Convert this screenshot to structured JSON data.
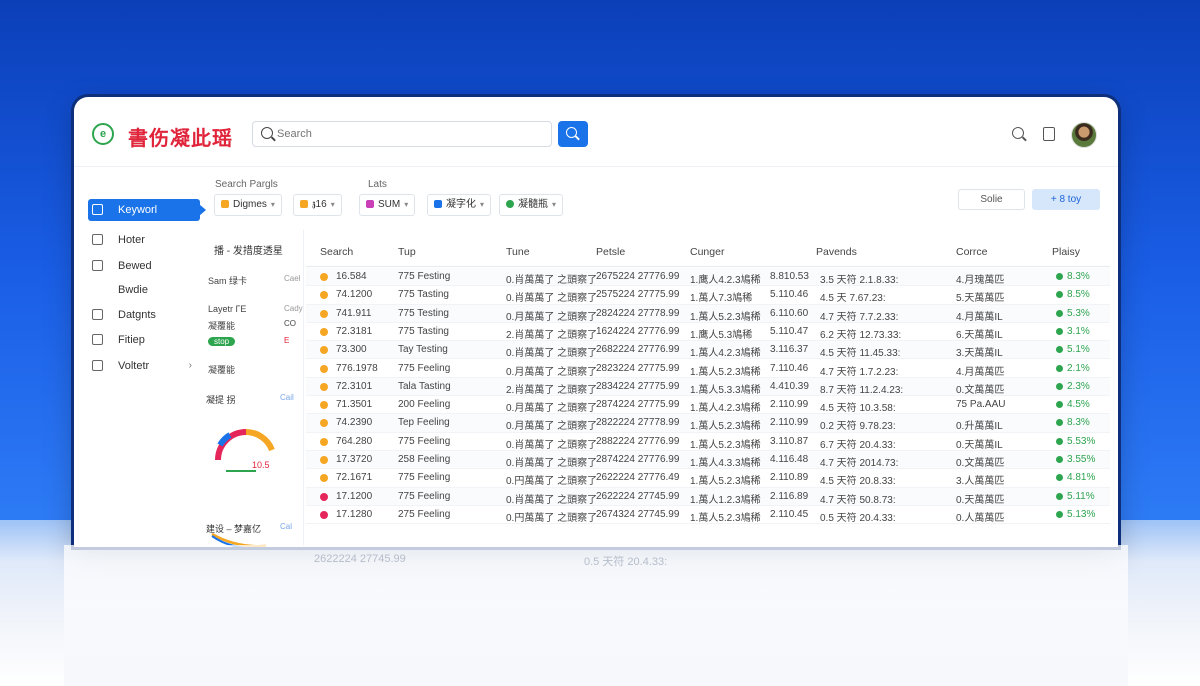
{
  "app": {
    "logo_text": "書伤凝此瑶"
  },
  "search": {
    "placeholder": "Search"
  },
  "sidebar": {
    "items": [
      {
        "label": "Keyworl"
      },
      {
        "label": "Hoter"
      },
      {
        "label": "Bewed"
      },
      {
        "label": "Bwdie"
      },
      {
        "label": "Datgnts"
      },
      {
        "label": "Fitiep"
      },
      {
        "label": "Voltetr"
      }
    ]
  },
  "filters": {
    "label_left": "Search Pargls",
    "label_right": "Lats",
    "chips": [
      "Digmes",
      "𝖟16",
      "SUM",
      "凝字化",
      "凝髓瓶"
    ],
    "btn_outline": "Solie",
    "btn_blue": "+ 8 toy"
  },
  "left_panel": {
    "header": "播 - 发措度透星",
    "rows": [
      {
        "left": "Sam 绿卡",
        "right": "Cael"
      },
      {
        "left": "Layetr ГЕ",
        "right": "Cady"
      },
      {
        "left": "凝覆能",
        "right": "CO"
      },
      {
        "left": "stop",
        "right": "E"
      },
      {
        "left": "凝覆能"
      }
    ],
    "gauge_title": "凝提 拐",
    "gauge_link": "Cail",
    "gauge_value": "10.5",
    "chart2_title": "建设 – 梦嘉亿",
    "chart2_link": "Cal"
  },
  "table": {
    "headers": [
      "Search",
      "Tup",
      "Tune",
      "Petsle",
      "Cunger",
      "Pavends",
      "Corrce",
      "Plaisy"
    ],
    "rows": [
      {
        "c1": "16.584",
        "c2": "775 Festing",
        "c3": "0.肖萬萬了 之頭察了",
        "c4": "2675224 27776.99",
        "c5": "1.鹰人4.2.3鳩稀",
        "c6": "8.810.53",
        "c7": "3.5 天符 2.1.8.33:",
        "c8": "4.月瑰萬匹",
        "c9": "8.3%",
        "dot": "#f5a623"
      },
      {
        "c1": "74.1200",
        "c2": "775 Tasting",
        "c3": "0.肖萬萬了 之頭察了",
        "c4": "2575224 27775.99",
        "c5": "1.萬人7.3鳩稀",
        "c6": "5.110.46",
        "c7": "4.5 天 7.67.23:",
        "c8": "5.天萬萬匹",
        "c9": "8.5%",
        "dot": "#f5a623"
      },
      {
        "c1": "741.911",
        "c2": "775 Testing",
        "c3": "0.月萬萬了 之頭察了",
        "c4": "2824224 27778.99",
        "c5": "1.萬人5.2.3鳩稀",
        "c6": "6.110.60",
        "c7": "4.7 天符 7.7.2.33:",
        "c8": "4.月萬萬IL",
        "c9": "5.3%",
        "dot": "#f5a623"
      },
      {
        "c1": "72.3181",
        "c2": "775 Tasting",
        "c3": "2.肖萬萬了 之頭察了",
        "c4": "1624224 27776.99",
        "c5": "1.鹰人5.3鳩稀",
        "c6": "5.110.47",
        "c7": "6.2 天符 12.73.33:",
        "c8": "6.天萬萬IL",
        "c9": "3.1%",
        "dot": "#f5a623"
      },
      {
        "c1": "73.300",
        "c2": "Tay Testing",
        "c3": "0.肖萬萬了 之頭察了",
        "c4": "2682224 27776.99",
        "c5": "1.萬人4.2.3鳩稀",
        "c6": "3.116.37",
        "c7": "4.5 天符 11.45.33:",
        "c8": "3.天萬萬IL",
        "c9": "5.1%",
        "dot": "#f5a623"
      },
      {
        "c1": "776.1978",
        "c2": "775 Feeling",
        "c3": "0.月萬萬了 之頭察了",
        "c4": "2823224 27775.99",
        "c5": "1.萬人5.2.3鳩稀",
        "c6": "7.110.46",
        "c7": "4.7 天符 1.7.2.23:",
        "c8": "4.月萬萬匹",
        "c9": "2.1%",
        "dot": "#f5a623"
      },
      {
        "c1": "72.3101",
        "c2": "Tala Tasting",
        "c3": "2.肖萬萬了 之頭察了",
        "c4": "2834224 27775.99",
        "c5": "1.萬人5.3.3鳩稀",
        "c6": "4.410.39",
        "c7": "8.7 天符 11.2.4.23:",
        "c8": "0.文萬萬匹",
        "c9": "2.3%",
        "dot": "#f5a623"
      },
      {
        "c1": "71.3501",
        "c2": "200 Feeling",
        "c3": "0.月萬萬了 之頭察了",
        "c4": "2874224 27775.99",
        "c5": "1.萬人4.2.3鳩稀",
        "c6": "2.110.99",
        "c7": "4.5 天符 10.3.58:",
        "c8": "75 Pa.AAU",
        "c9": "4.5%",
        "dot": "#f5a623"
      },
      {
        "c1": "74.2390",
        "c2": "Tep Feeling",
        "c3": "0.月萬萬了 之頭察了",
        "c4": "2822224 27778.99",
        "c5": "1.萬人5.2.3鳩稀",
        "c6": "2.110.99",
        "c7": "0.2 天符 9.78.23:",
        "c8": "0.升萬萬IL",
        "c9": "8.3%",
        "dot": "#f5a623"
      },
      {
        "c1": "764.280",
        "c2": "775 Feeling",
        "c3": "0.肖萬萬了 之頭察了",
        "c4": "2882224 27776.99",
        "c5": "1.萬人5.2.3鳩稀",
        "c6": "3.110.87",
        "c7": "6.7 天符 20.4.33:",
        "c8": "0.天萬萬IL",
        "c9": "5.53%",
        "dot": "#f5a623"
      },
      {
        "c1": "17.3720",
        "c2": "258 Feeling",
        "c3": "0.肖萬萬了 之頭察了",
        "c4": "2874224 27776.99",
        "c5": "1.萬人4.3.3鳩稀",
        "c6": "4.116.48",
        "c7": "4.7 天符 2014.73:",
        "c8": "0.文萬萬匹",
        "c9": "3.55%",
        "dot": "#f5a623"
      },
      {
        "c1": "72.1671",
        "c2": "775 Feeling",
        "c3": "0.円萬萬了 之頭察了",
        "c4": "2622224 27776.49",
        "c5": "1.萬人5.2.3鳩稀",
        "c6": "2.110.89",
        "c7": "4.5 天符 20.8.33:",
        "c8": "3.人萬萬匹",
        "c9": "4.81%",
        "dot": "#f5a623"
      },
      {
        "c1": "17.1200",
        "c2": "775 Feeling",
        "c3": "0.肖萬萬了 之頭察了",
        "c4": "2622224 27745.99",
        "c5": "1.萬人1.2.3鳩稀",
        "c6": "2.116.89",
        "c7": "4.7 天符 50.8.73:",
        "c8": "0.天萬萬匹",
        "c9": "5.11%",
        "dot": "#e5265b"
      },
      {
        "c1": "17.1280",
        "c2": "275 Feeling",
        "c3": "0.円萬萬了 之頭察了",
        "c4": "2674324 27745.99",
        "c5": "1.萬人5.2.3鳩稀",
        "c6": "2.110.45",
        "c7": "0.5 天符 20.4.33:",
        "c8": "0.人萬萬匹",
        "c9": "5.13%",
        "dot": "#e5265b"
      }
    ]
  },
  "colors": {
    "accent": "#1a73e8",
    "logo": "#e0243a",
    "positive": "#2da44e",
    "warn_dot": "#f5a623",
    "alert_dot": "#e5265b"
  }
}
